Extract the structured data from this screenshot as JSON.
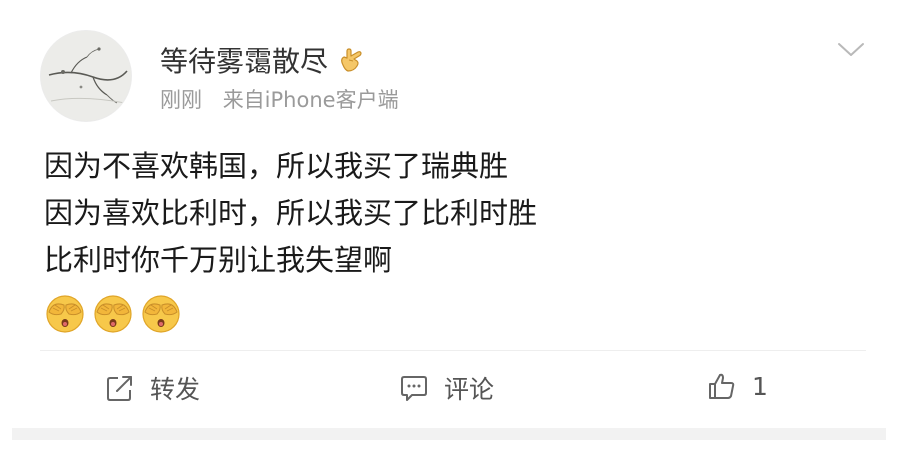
{
  "post": {
    "username": "等待雾霭散尽",
    "badge_icon": "hand-gesture-icon",
    "time": "刚刚",
    "source": "来自iPhone客户端",
    "lines": [
      "因为不喜欢韩国，所以我买了瑞典胜",
      "因为喜欢比利时，所以我买了比利时胜",
      "比利时你千万别让我失望啊"
    ],
    "emojis": [
      "see-no-evil-monkey-emoji",
      "see-no-evil-monkey-emoji",
      "see-no-evil-monkey-emoji"
    ]
  },
  "actions": {
    "repost_label": "转发",
    "comment_label": "评论",
    "like_count": "1"
  },
  "colors": {
    "text_primary": "#1a1a1a",
    "text_meta": "#9a9a9a",
    "divider": "#eeeeee",
    "emoji_yellow": "#f7c84a"
  }
}
